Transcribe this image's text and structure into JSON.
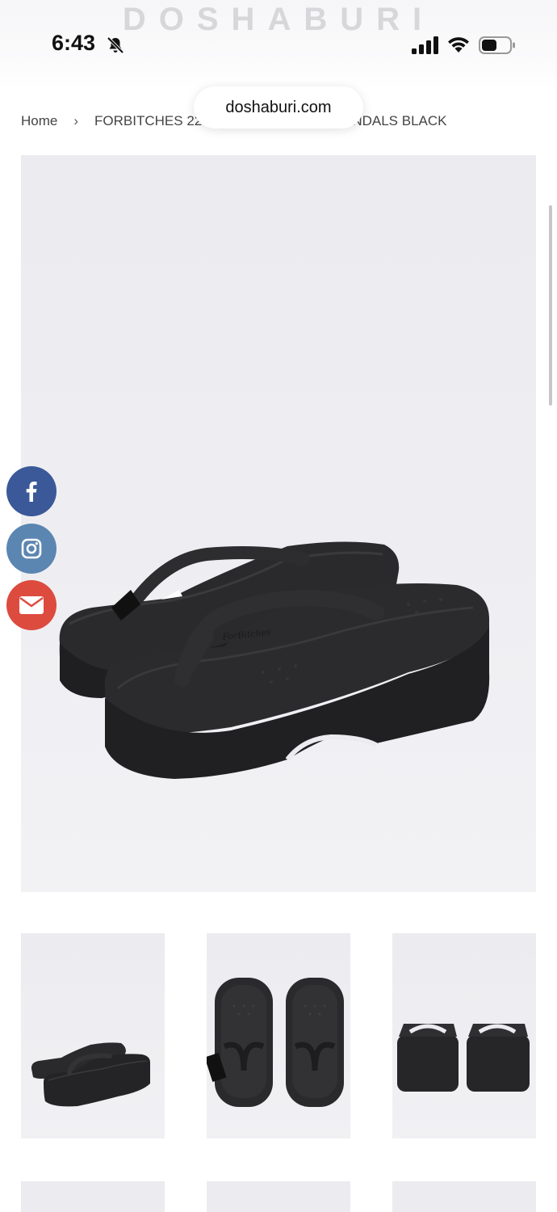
{
  "status_bar": {
    "brand": "DOSHABURI",
    "time": "6:43"
  },
  "browser": {
    "url": "doshaburi.com"
  },
  "breadcrumb": {
    "home": "Home",
    "separator": "›",
    "current": "FORBITCHES 22SS EE CODE EWEE SANDALS BLACK"
  },
  "social": {
    "facebook_glyph": "f",
    "icons": [
      "facebook-icon",
      "instagram-icon",
      "email-icon"
    ]
  },
  "colors": {
    "facebook": "#3b5998",
    "instagram": "#5b86b1",
    "email": "#dd4b3f",
    "sandal": "#2b2b2d"
  },
  "images": {
    "main": "black platform flip-flop sandals, side view",
    "thumbnails": [
      "sandals side view",
      "sandals top view",
      "sandals back view"
    ]
  }
}
